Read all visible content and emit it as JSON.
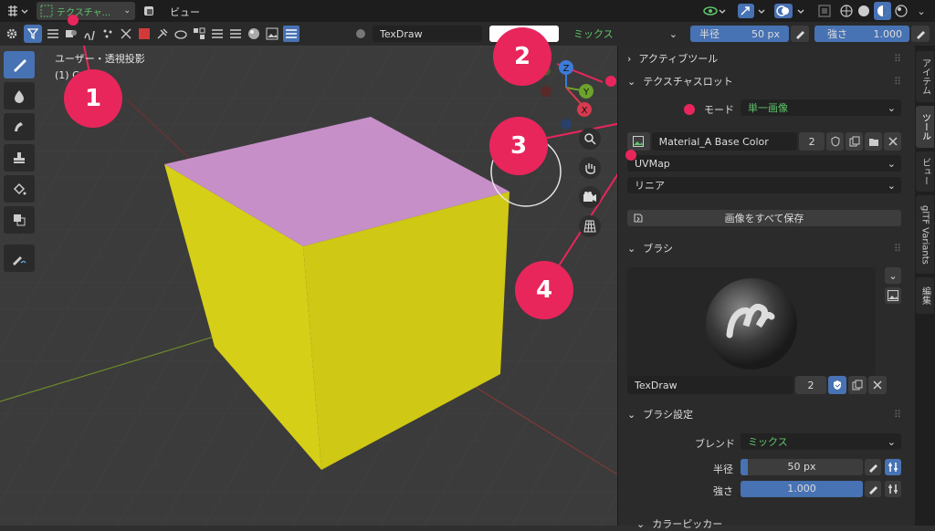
{
  "topbar": {
    "mode_label": "テクスチャ...",
    "view_menu": "ビュー"
  },
  "toolheader": {
    "brush_name": "TexDraw",
    "blend_value": "ミックス",
    "radius_label": "半径",
    "radius_value": "50 px",
    "strength_label": "強さ",
    "strength_value": "1.000"
  },
  "viewport": {
    "view_title": "ユーザー・透視投影",
    "object_label": "(1) Cu",
    "gizmo_axes": [
      "Z",
      "Y",
      "X"
    ]
  },
  "panel": {
    "active_tool": "アクティブツール",
    "texture_slots": "テクスチャスロット",
    "mode_label": "モード",
    "mode_value": "単一画像",
    "image_name": "Material_A Base Color",
    "image_users": "2",
    "uv_map": "UVMap",
    "interpolation": "リニア",
    "save_all": "画像をすべて保存",
    "brush_section": "ブラシ",
    "brush_name": "TexDraw",
    "brush_users": "2",
    "brush_settings": "ブラシ設定",
    "blend_label": "ブレンド",
    "blend_value": "ミックス",
    "radius_label": "半径",
    "radius_value": "50 px",
    "strength_label": "強さ",
    "strength_value": "1.000",
    "color_picker": "カラーピッカー"
  },
  "tabs": [
    "アイテム",
    "ツール",
    "ビュー",
    "glTF Variants",
    "編集"
  ],
  "markers": [
    "1",
    "2",
    "3",
    "4"
  ],
  "colors": {
    "accent_blue": "#4772b3",
    "marker_pink": "#e8265c",
    "cube_yellow": "#d4cc14",
    "cube_top": "#c68fc8"
  }
}
